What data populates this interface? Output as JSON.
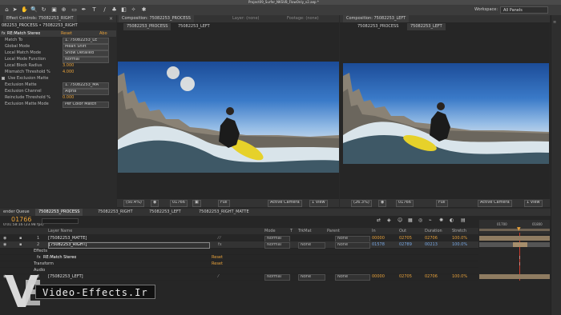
{
  "app": {
    "title": "Project09_Surfer_NKSVB_FlowOnly_v2.aep *",
    "workspace_label": "Workspace:",
    "workspace_value": "All Panels"
  },
  "effect_controls": {
    "tab": "Effect Controls: 75082253_RIGHT",
    "breadcrumb": "082253_PROCESS • 75082253_RIGHT",
    "effect_name": "RE:Match Stereo",
    "reset": "Reset",
    "about": "Abo",
    "params": [
      {
        "label": "Match To",
        "value": "1. 75082253_LE",
        "kind": "select"
      },
      {
        "label": "Global Mode",
        "value": "Mean Shift",
        "kind": "select"
      },
      {
        "label": "Local Match Mode",
        "value": "Show Detailed",
        "kind": "select"
      },
      {
        "label": "Local Mode Function",
        "value": "Normal",
        "kind": "select"
      },
      {
        "label": "Local Block Radius",
        "value": "3.000",
        "kind": "number"
      },
      {
        "label": "Mismatch Threshold %",
        "value": "4.000",
        "kind": "number"
      },
      {
        "label": "Use Exclusion Matte",
        "value": "",
        "kind": "check"
      },
      {
        "label": "Exclusion Matte",
        "value": "1. 75082253_MA",
        "kind": "select"
      },
      {
        "label": "Exclusion Channel",
        "value": "Alpha",
        "kind": "select"
      },
      {
        "label": "Reinclude Threshold %",
        "value": "0.000",
        "kind": "number"
      },
      {
        "label": "Exclusion Matte Mode",
        "value": "Per Color Match",
        "kind": "select"
      }
    ]
  },
  "comp_left": {
    "tab": "Composition: 75082253_PROCESS",
    "sub_tabs": [
      "75082253_PROCESS",
      "75082253_LEFT"
    ],
    "extra_tabs": [
      "Layer: (none)",
      "Footage: (none)"
    ],
    "zoom": "(50.4%)",
    "timecode": "01766",
    "resolution": "Full",
    "camera": "Active Camera",
    "view": "1 View"
  },
  "comp_right": {
    "tab": "Composition: 75082253_LEFT",
    "sub_tabs": [
      "75082253_PROCESS",
      "75082253_LEFT"
    ],
    "zoom": "(26.3%)",
    "timecode": "01766",
    "resolution": "Full",
    "camera": "Active Camera",
    "view": "1 View"
  },
  "timeline": {
    "tabs": [
      "ender Queue",
      "75082253_PROCESS",
      "75082253_RIGHT",
      "75082253_LEFT",
      "75082253_RIGHT_MATTE"
    ],
    "current_time": "01766",
    "fps_line": "0:01:58:16 (23.98 fps)",
    "columns": [
      "Layer Name",
      "Mode",
      "T",
      "TrkMat",
      "Parent",
      "In",
      "Out",
      "Duration",
      "Stretch"
    ],
    "ruler": [
      "01700",
      "01800"
    ],
    "layers": [
      {
        "num": "1",
        "name": "[75082253_MATTE]",
        "mode": "Normal",
        "trkmat": "",
        "parent": "None",
        "in": "00000",
        "out": "02705",
        "duration": "02706",
        "stretch": "100.0%"
      },
      {
        "num": "2",
        "name": "[75082253_RIGHT]",
        "mode": "Normal",
        "trkmat": "None",
        "parent": "None",
        "in": "01578",
        "out": "02789",
        "duration": "00213",
        "stretch": "100.0%"
      },
      {
        "num": "3",
        "name": "[75082253_LEFT]",
        "mode": "Normal",
        "trkmat": "None",
        "parent": "None",
        "in": "00000",
        "out": "02705",
        "duration": "02706",
        "stretch": "100.0%"
      }
    ],
    "sub_rows": [
      {
        "label": "Effects",
        "reset": ""
      },
      {
        "label": "RE:Match Stereo",
        "reset": "Reset"
      },
      {
        "label": "Transform",
        "reset": "Reset"
      },
      {
        "label": "Audio",
        "reset": ""
      }
    ]
  },
  "watermark": {
    "text": "Video-Effects.Ir",
    "logo": "VE"
  },
  "colors": {
    "accent": "#e7a13a",
    "link": "#79a9e6",
    "panel": "#2a2a2a",
    "clip_bar": "#8f7c61"
  }
}
